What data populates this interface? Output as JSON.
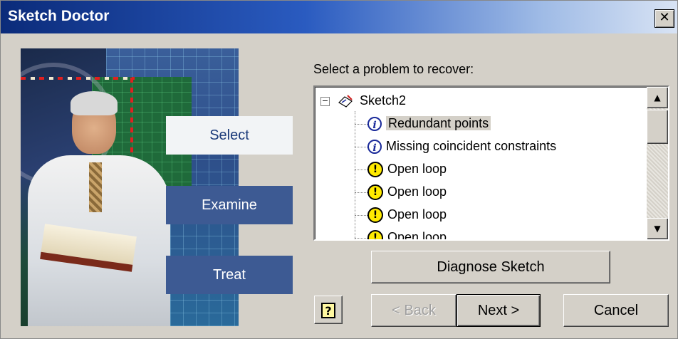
{
  "window": {
    "title": "Sketch Doctor",
    "close_glyph": "✕"
  },
  "steps": {
    "select": "Select",
    "examine": "Examine",
    "treat": "Treat"
  },
  "prompt": "Select a problem to recover:",
  "tree": {
    "expander": "−",
    "root_label": "Sketch2",
    "items": [
      {
        "icon": "info-icon",
        "label": "Redundant points",
        "selected": true
      },
      {
        "icon": "info-icon",
        "label": "Missing coincident constraints",
        "selected": false
      },
      {
        "icon": "warning-icon",
        "label": "Open loop",
        "selected": false
      },
      {
        "icon": "warning-icon",
        "label": "Open loop",
        "selected": false
      },
      {
        "icon": "warning-icon",
        "label": "Open loop",
        "selected": false
      },
      {
        "icon": "warning-icon",
        "label": "Open loop",
        "selected": false
      }
    ],
    "scroll_up_glyph": "▲",
    "scroll_down_glyph": "▼"
  },
  "buttons": {
    "diagnose": "Diagnose Sketch",
    "help": "?",
    "back": "< Back",
    "next": "Next >",
    "cancel": "Cancel"
  },
  "colors": {
    "title_gradient_start": "#0b2b7a",
    "step_active_bg": "#f2f4f6",
    "step_inactive_bg": "#3d5a93",
    "warning_yellow": "#ffea00",
    "info_blue": "#1a2a9a"
  }
}
